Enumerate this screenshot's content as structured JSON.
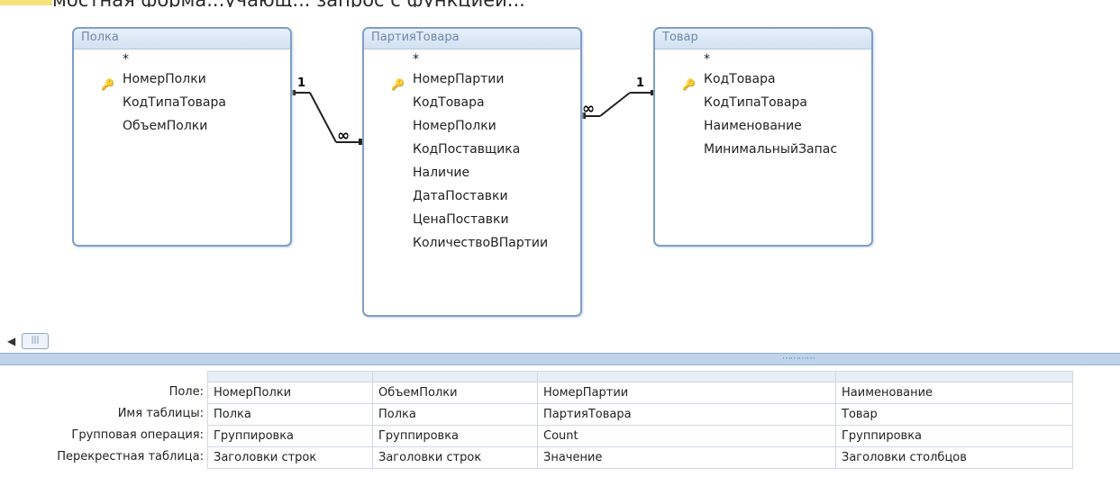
{
  "header": {
    "clipped_text": "мостная форма...учающ... запрос с функцией..."
  },
  "tables": [
    {
      "title": "Полка",
      "fields": [
        "*",
        "НомерПолки",
        "КодТипаТовара",
        "ОбъемПолки"
      ],
      "key_index": 1
    },
    {
      "title": "ПартияТовара",
      "fields": [
        "*",
        "НомерПартии",
        "КодТовара",
        "НомерПолки",
        "КодПоставщика",
        "Наличие",
        "ДатаПоставки",
        "ЦенаПоставки",
        "КоличествоВПартии"
      ],
      "key_index": 1
    },
    {
      "title": "Товар",
      "fields": [
        "*",
        "КодТовара",
        "КодТипаТовара",
        "Наименование",
        "МинимальныйЗапас"
      ],
      "key_index": 1
    }
  ],
  "relationships": [
    {
      "one_label": "1",
      "many_label": "∞"
    },
    {
      "one_label": "1",
      "many_label": "∞"
    }
  ],
  "scroll": {
    "left_arrow": "◀",
    "thumb": "|||",
    "grip": "⋯⋯⋯⋯"
  },
  "grid": {
    "row_labels": [
      "Поле:",
      "Имя таблицы:",
      "Групповая операция:",
      "Перекрестная таблица:"
    ],
    "columns": [
      [
        "НомерПолки",
        "Полка",
        "Группировка",
        "Заголовки строк"
      ],
      [
        "ОбъемПолки",
        "Полка",
        "Группировка",
        "Заголовки строк"
      ],
      [
        "НомерПартии",
        "ПартияТовара",
        "Count",
        "Значение"
      ],
      [
        "Наименование",
        "Товар",
        "Группировка",
        "Заголовки столбцов"
      ]
    ]
  }
}
